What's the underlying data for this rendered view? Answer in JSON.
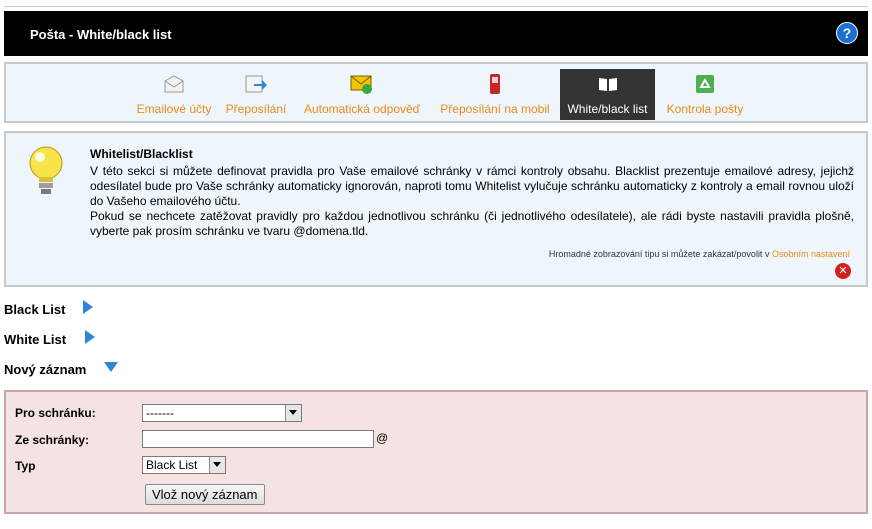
{
  "header": {
    "title": "Pošta - White/black list",
    "help_icon": "question-icon",
    "help_glyph": "?"
  },
  "tabs": [
    {
      "label": "Emailové účty",
      "icon": "envelope-icon",
      "active": false
    },
    {
      "label": "Přeposílání",
      "icon": "forward-icon",
      "active": false
    },
    {
      "label": "Automatická odpověď",
      "icon": "autoreply-icon",
      "active": false
    },
    {
      "label": "Přeposílání na mobil",
      "icon": "mobile-icon",
      "active": false
    },
    {
      "label": "White/black list",
      "icon": "book-icon",
      "active": true
    },
    {
      "label": "Kontrola pošty",
      "icon": "recycle-icon",
      "active": false
    }
  ],
  "info": {
    "title": "Whitelist/Blacklist",
    "paragraph1": "V této sekci si můžete definovat pravidla pro Vaše emailové schránky v rámci kontroly obsahu. Blacklist prezentuje emailové adresy, jejichž odesílatel bude pro Vaše schránky automaticky ignorován, naproti tomu Whitelist vylučuje schránku automaticky z kontroly a email rovnou uloží do Vašeho emailového účtu.",
    "paragraph2": "Pokud se nechcete zatěžovat pravidly pro každou jednotlivou schránku (či jednotlivého odesílatele), ale rádi byste nastavili pravidla plošně, vyberte pak prosím schránku ve tvaru @domena.tld.",
    "hint_text": "Hromadné zobrazování tipu si můžete zakázat/povolit v ",
    "hint_link": "Osobním nastavení",
    "close_glyph": "✕"
  },
  "sections": {
    "black_list": "Black List",
    "white_list": "White List",
    "new_record": "Nový záznam"
  },
  "form": {
    "mailbox_label": "Pro schránku:",
    "mailbox_value": "-------",
    "from_label": "Ze schránky:",
    "from_value": "",
    "at_sign": "@",
    "type_label": "Typ",
    "type_value": "Black List",
    "submit_label": "Vlož nový záznam"
  },
  "colors": {
    "accent": "#ec8a16",
    "arrow": "#2f86d8",
    "form_bg": "#f5e2e2",
    "panel_bg": "#eef6fb"
  }
}
